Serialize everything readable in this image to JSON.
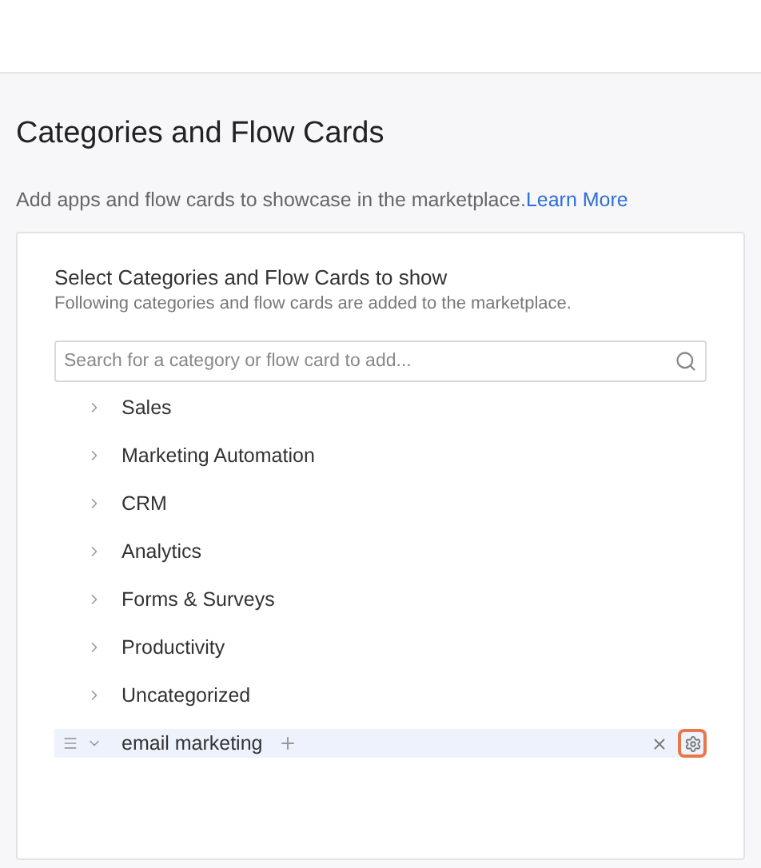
{
  "page_title": "Categories and Flow Cards",
  "description": "Add apps and flow cards to showcase in the marketplace.",
  "learn_more_link": "Learn More",
  "card": {
    "title": "Select Categories and Flow Cards to show",
    "subtitle": "Following categories and flow cards are added to the marketplace.",
    "search": {
      "placeholder": "Search for a category or flow card to add..."
    },
    "items": [
      {
        "label": "Sales",
        "expanded": false,
        "selected": false
      },
      {
        "label": "Marketing Automation",
        "expanded": false,
        "selected": false
      },
      {
        "label": "CRM",
        "expanded": false,
        "selected": false
      },
      {
        "label": "Analytics",
        "expanded": false,
        "selected": false
      },
      {
        "label": "Forms & Surveys",
        "expanded": false,
        "selected": false
      },
      {
        "label": "Productivity",
        "expanded": false,
        "selected": false
      },
      {
        "label": "Uncategorized",
        "expanded": false,
        "selected": false
      },
      {
        "label": "email marketing",
        "expanded": true,
        "selected": true
      }
    ]
  }
}
